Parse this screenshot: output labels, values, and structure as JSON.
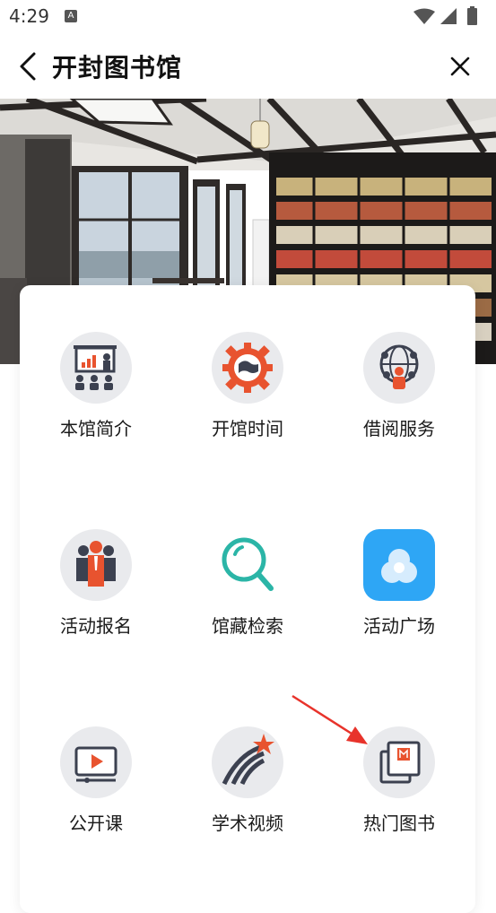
{
  "status_bar": {
    "time": "4:29",
    "indicator": "A"
  },
  "nav": {
    "title": "开封图书馆",
    "back_icon": "back-arrow-icon",
    "close_icon": "close-icon"
  },
  "banner": {
    "image": "library-interior-photo"
  },
  "menu": {
    "items": [
      {
        "label": "本馆简介",
        "icon": "presentation-icon"
      },
      {
        "label": "开馆时间",
        "icon": "gear-globe-icon"
      },
      {
        "label": "借阅服务",
        "icon": "network-person-icon"
      },
      {
        "label": "活动报名",
        "icon": "people-group-icon"
      },
      {
        "label": "馆藏检索",
        "icon": "search-icon"
      },
      {
        "label": "活动广场",
        "icon": "circles-app-icon"
      },
      {
        "label": "公开课",
        "icon": "video-play-icon"
      },
      {
        "label": "学术视频",
        "icon": "shooting-star-icon"
      },
      {
        "label": "热门图书",
        "icon": "books-icon"
      }
    ]
  },
  "annotation": {
    "arrow_color": "#e8332b"
  }
}
